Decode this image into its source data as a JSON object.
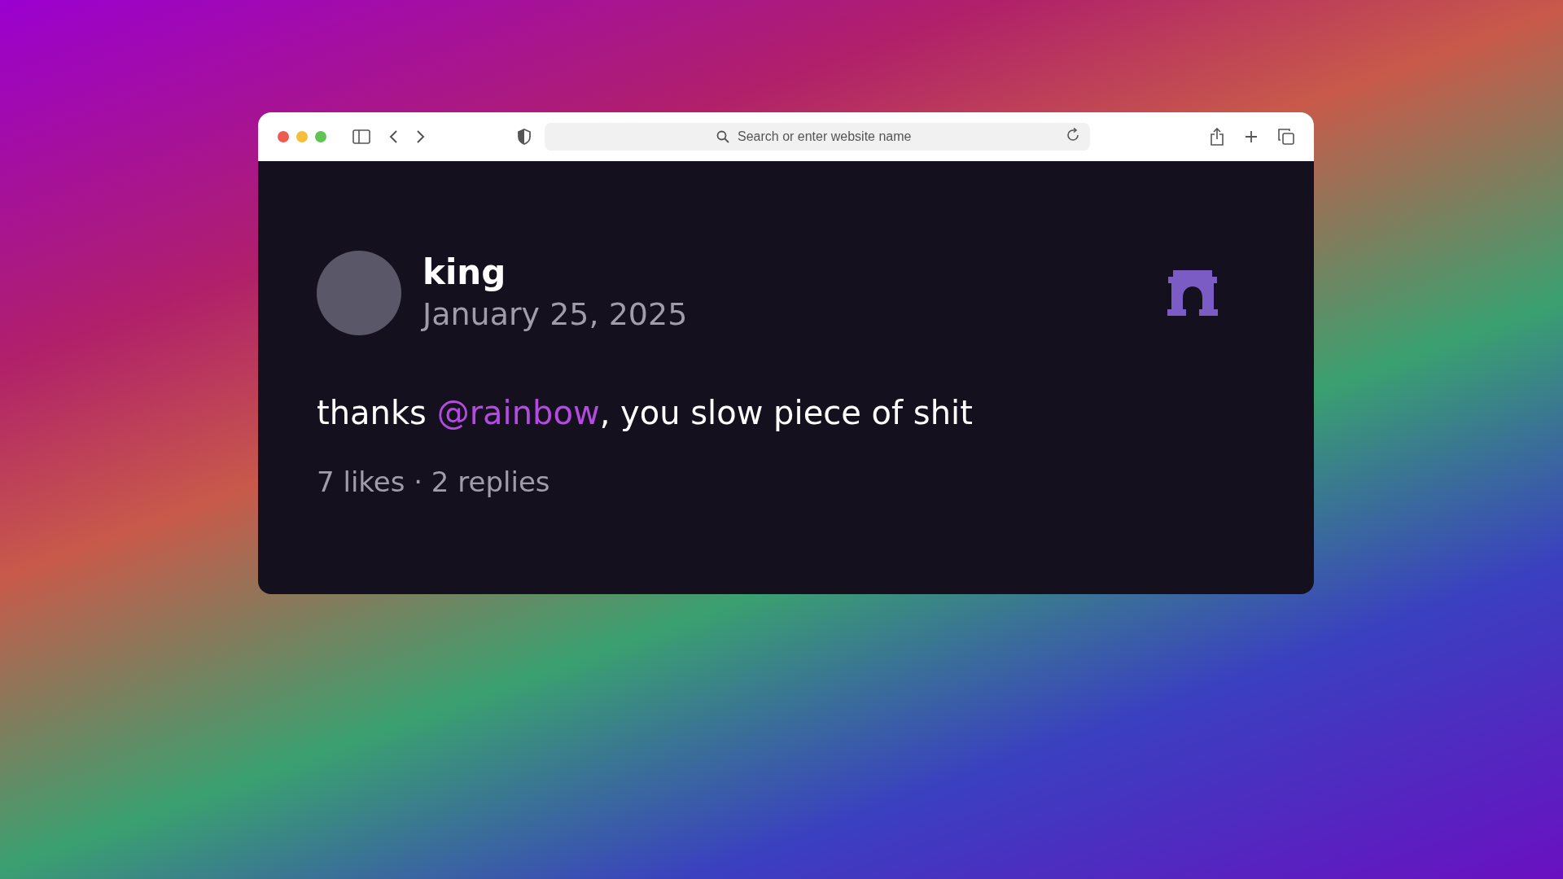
{
  "browser": {
    "address_placeholder": "Search or enter website name"
  },
  "post": {
    "author": "king",
    "date": "January 25, 2025",
    "body": [
      {
        "kind": "text",
        "text": "thanks "
      },
      {
        "kind": "mention",
        "text": "@rainbow"
      },
      {
        "kind": "text",
        "text": ", you slow piece of shit"
      }
    ],
    "stats": "7 likes · 2 replies"
  }
}
